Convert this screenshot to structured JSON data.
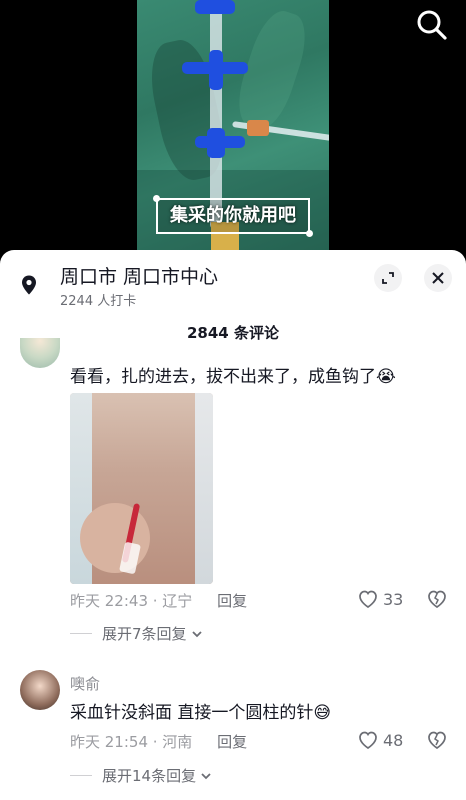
{
  "video": {
    "caption": "集采的你就用吧",
    "search_icon": "search-icon"
  },
  "location": {
    "title": "周口市  周口市中心",
    "checkins": "2244 人打卡",
    "pin_icon": "location-pin-icon",
    "expand_icon": "expand-icon",
    "close_icon": "close-icon"
  },
  "comments_header": {
    "count_label": "2844 条评论"
  },
  "comments": [
    {
      "username": "",
      "text": "看看，扎的进去，拔不出来了，成鱼钩了😭",
      "time_location": "昨天 22:43 · 辽宁",
      "reply_label": "回复",
      "likes": "33",
      "expand_replies": "展开7条回复"
    },
    {
      "username": "噢俞",
      "text": "采血针没斜面 直接一个圆柱的针😅",
      "time_location": "昨天 21:54 · 河南",
      "reply_label": "回复",
      "likes": "48",
      "expand_replies": "展开14条回复"
    }
  ]
}
